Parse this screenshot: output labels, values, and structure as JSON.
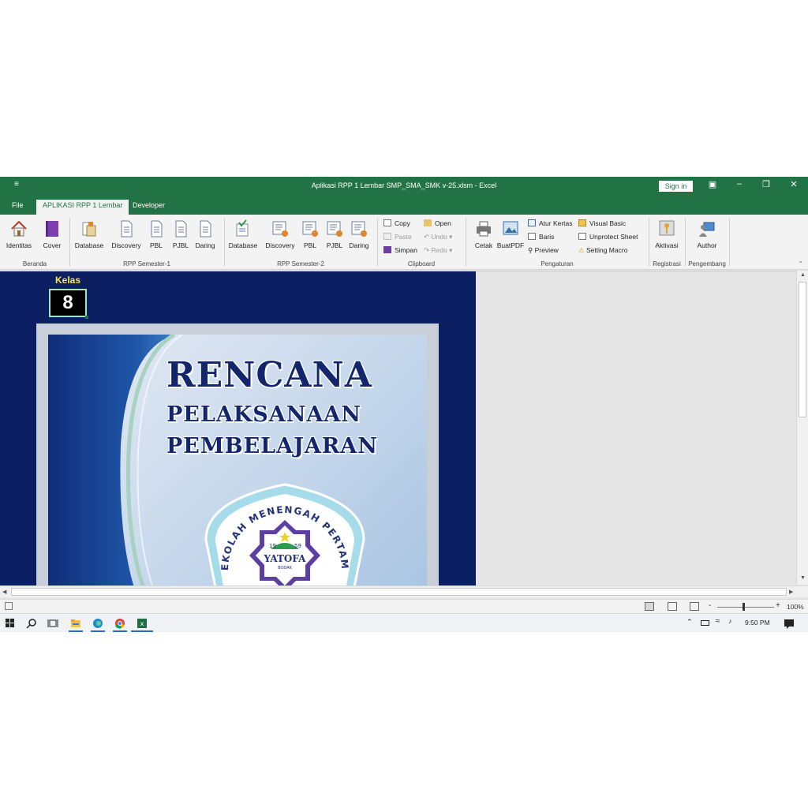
{
  "window": {
    "title": "Aplikasi RPP 1 Lembar SMP_SMA_SMK v-25.xlsm  -  Excel",
    "qat_icon": "customize-qat-icon",
    "sign_in": "Sign in"
  },
  "tabs": [
    "File",
    "APLIKASI RPP 1 Lembar",
    "Developer"
  ],
  "ribbon": {
    "beranda": {
      "label": "Beranda",
      "identitas": "Identitas",
      "cover": "Cover"
    },
    "sem1": {
      "label": "RPP Semester-1",
      "database": "Database",
      "discovery": "Discovery",
      "pbl": "PBL",
      "pjbl": "PJBL",
      "daring": "Daring"
    },
    "sem2": {
      "label": "RPP Semester-2",
      "database": "Database",
      "discovery": "Discovery",
      "pbl": "PBL",
      "pjbl": "PJBL",
      "daring": "Daring"
    },
    "clipboard": {
      "label": "Clipboard",
      "copy": "Copy",
      "paste": "Paste",
      "simpan": "Simpan",
      "open": "Open",
      "undo": "Undo",
      "redo": "Redo"
    },
    "pengaturan": {
      "label": "Pengaturan",
      "cetak": "Cetak",
      "buatpdf": "BuatPDF",
      "atur_kertas": "Atur Kertas",
      "baris": "Baris",
      "preview": "Preview",
      "visual_basic": "Visual Basic",
      "unprotect": "Unprotect Sheet",
      "setting_macro": "Setting Macro"
    },
    "registrasi": {
      "label": "Registrasi",
      "aktivasi": "Aktivasi"
    },
    "pengembang": {
      "label": "Pengembang",
      "author": "Author"
    }
  },
  "sheet": {
    "kelas_label": "Kelas",
    "kelas_value": "8",
    "cover": {
      "title_1": "RENCANA",
      "title_2": "PELAKSANAAN",
      "title_3": "PEMBELAJARAN",
      "logo_arc_text": "SEKOLAH MENENGAH PERTAMA",
      "logo_year_left": "19",
      "logo_year_right": "59",
      "logo_name": "YATOFA",
      "logo_sub": "BODAK"
    }
  },
  "statusbar": {
    "zoom": "100%",
    "zoom_minus": "-",
    "zoom_plus": "+"
  },
  "taskbar": {
    "time": "9:50 PM"
  },
  "colors": {
    "excel_green": "#217346",
    "sheet_navy": "#0c1f62",
    "title_navy": "#14266b",
    "kelas_yellow": "#ffe34d"
  }
}
